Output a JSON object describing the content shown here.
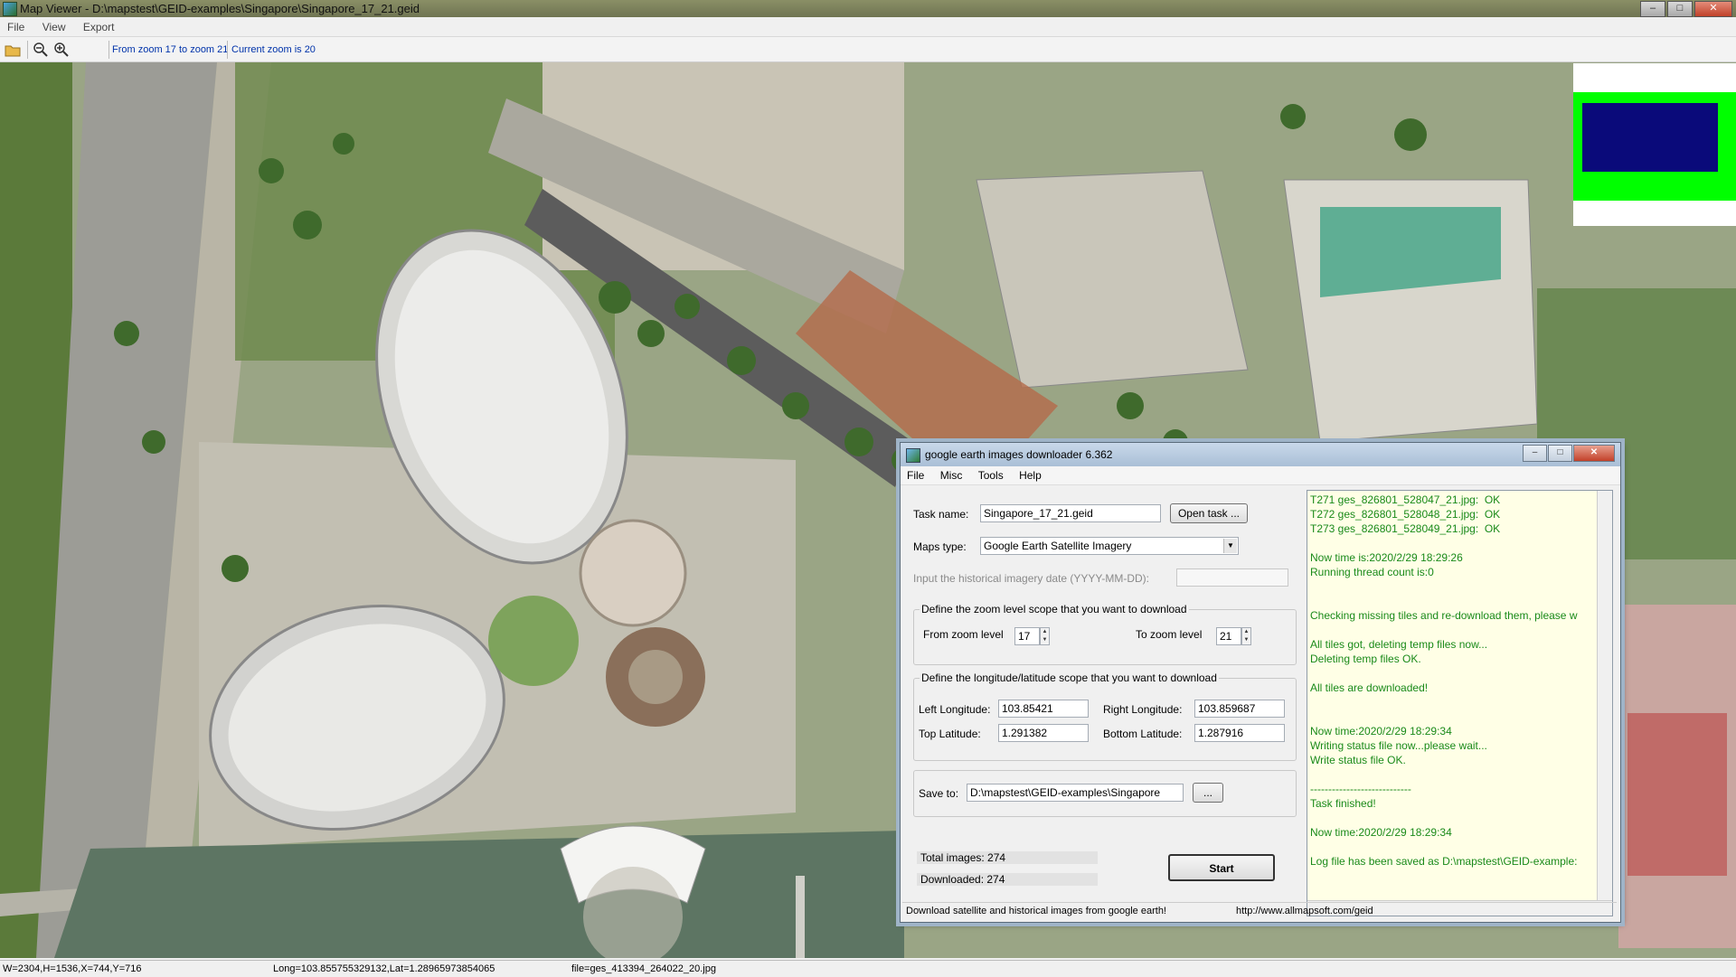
{
  "window": {
    "title": "Map Viewer - D:\\mapstest\\GEID-examples\\Singapore\\Singapore_17_21.geid",
    "buttons": [
      "–",
      "□",
      "✕"
    ]
  },
  "menubar": {
    "items": [
      "File",
      "View",
      "Export"
    ]
  },
  "toolbar": {
    "icons": [
      "open-folder-icon",
      "zoom-out-icon",
      "zoom-in-icon"
    ],
    "zoom_range": "From zoom 17 to zoom 21",
    "current_zoom": "Current zoom is 20"
  },
  "statusbar": {
    "size": "W=2304,H=1536,X=744,Y=716",
    "coords": "Long=103.855755329132,Lat=1.28965973854065",
    "file": "file=ges_413394_264022_20.jpg"
  },
  "colors": {
    "overview_border": "#00ff00",
    "overview_fill": "#0a0a7a",
    "log_text": "#1a8a1a",
    "log_bg": "#ffffe6"
  },
  "dialog": {
    "title": "google earth images downloader 6.362",
    "menu": [
      "File",
      "Misc",
      "Tools",
      "Help"
    ],
    "task_name_label": "Task name:",
    "task_name_value": "Singapore_17_21.geid",
    "open_task_button": "Open task ...",
    "maps_type_label": "Maps type:",
    "maps_type_value": "Google Earth Satellite Imagery",
    "historical_label": "Input the  historical imagery date (YYYY-MM-DD):",
    "historical_value": "",
    "zoom_group": {
      "legend": "Define the zoom level scope that you want to download",
      "from_label": "From zoom level",
      "from_value": "17",
      "to_label": "To zoom level",
      "to_value": "21"
    },
    "lonlat_group": {
      "legend": "Define the longitude/latitude scope that you want to download",
      "left_label": "Left Longitude:",
      "left_value": "103.85421",
      "right_label": "Right Longitude:",
      "right_value": "103.859687",
      "top_label": "Top Latitude:",
      "top_value": "1.291382",
      "bottom_label": "Bottom Latitude:",
      "bottom_value": "1.287916"
    },
    "save_to_label": "Save to:",
    "save_to_value": "D:\\mapstest\\GEID-examples\\Singapore",
    "browse_button": "...",
    "total_images": "Total images: 274",
    "downloaded": "Downloaded: 274",
    "start_button": "Start",
    "log": [
      "T271 ges_826801_528047_21.jpg:  OK",
      "T272 ges_826801_528048_21.jpg:  OK",
      "T273 ges_826801_528049_21.jpg:  OK",
      "",
      "Now time is:2020/2/29 18:29:26",
      "Running thread count is:0",
      "",
      "",
      "Checking missing tiles and re-download them, please w",
      "",
      "All tiles got, deleting temp files now...",
      "Deleting temp files OK.",
      "",
      "All tiles are downloaded!",
      "",
      "",
      "Now time:2020/2/29 18:29:34",
      "Writing status file now...please wait...",
      "Write status file OK.",
      "",
      "----------------------------",
      "Task finished!",
      "",
      "Now time:2020/2/29 18:29:34",
      "",
      "Log file has been saved as D:\\mapstest\\GEID-example:"
    ],
    "status_left": "Download satellite and historical  images from google earth!",
    "status_right": "http://www.allmapsoft.com/geid"
  }
}
